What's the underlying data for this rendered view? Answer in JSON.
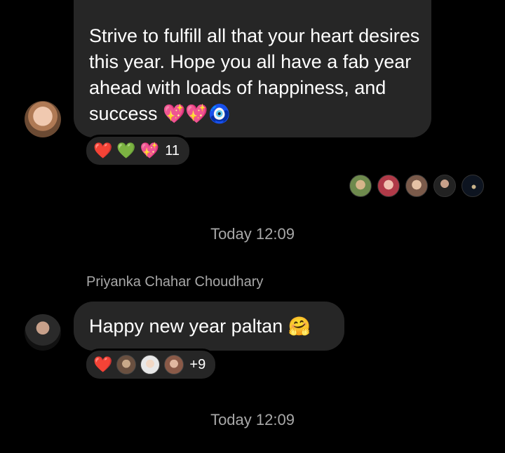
{
  "messages": [
    {
      "text": "Strive to fulfill all that your heart desires this year. Hope you all have a fab year ahead with loads of happiness, and success",
      "trailing_emojis": "💖💖🧿",
      "reactions": {
        "emojis": [
          "❤️",
          "💚",
          "💖"
        ],
        "count": "11"
      }
    },
    {
      "sender": "Priyanka Chahar Choudhary",
      "text": "Happy new year paltan",
      "trailing_emoji": "🤗",
      "reactions": {
        "emoji": "❤️",
        "count": "+9"
      }
    }
  ],
  "timestamps": [
    "Today 12:09",
    "Today 12:09"
  ],
  "colors": {
    "background": "#000000",
    "bubble": "#262626",
    "muted_text": "#a8a8a8"
  },
  "icons": {
    "seen_by": [
      "avatar",
      "avatar",
      "avatar",
      "avatar",
      "avatar"
    ],
    "reaction_avatars": [
      "avatar",
      "avatar",
      "avatar"
    ]
  }
}
